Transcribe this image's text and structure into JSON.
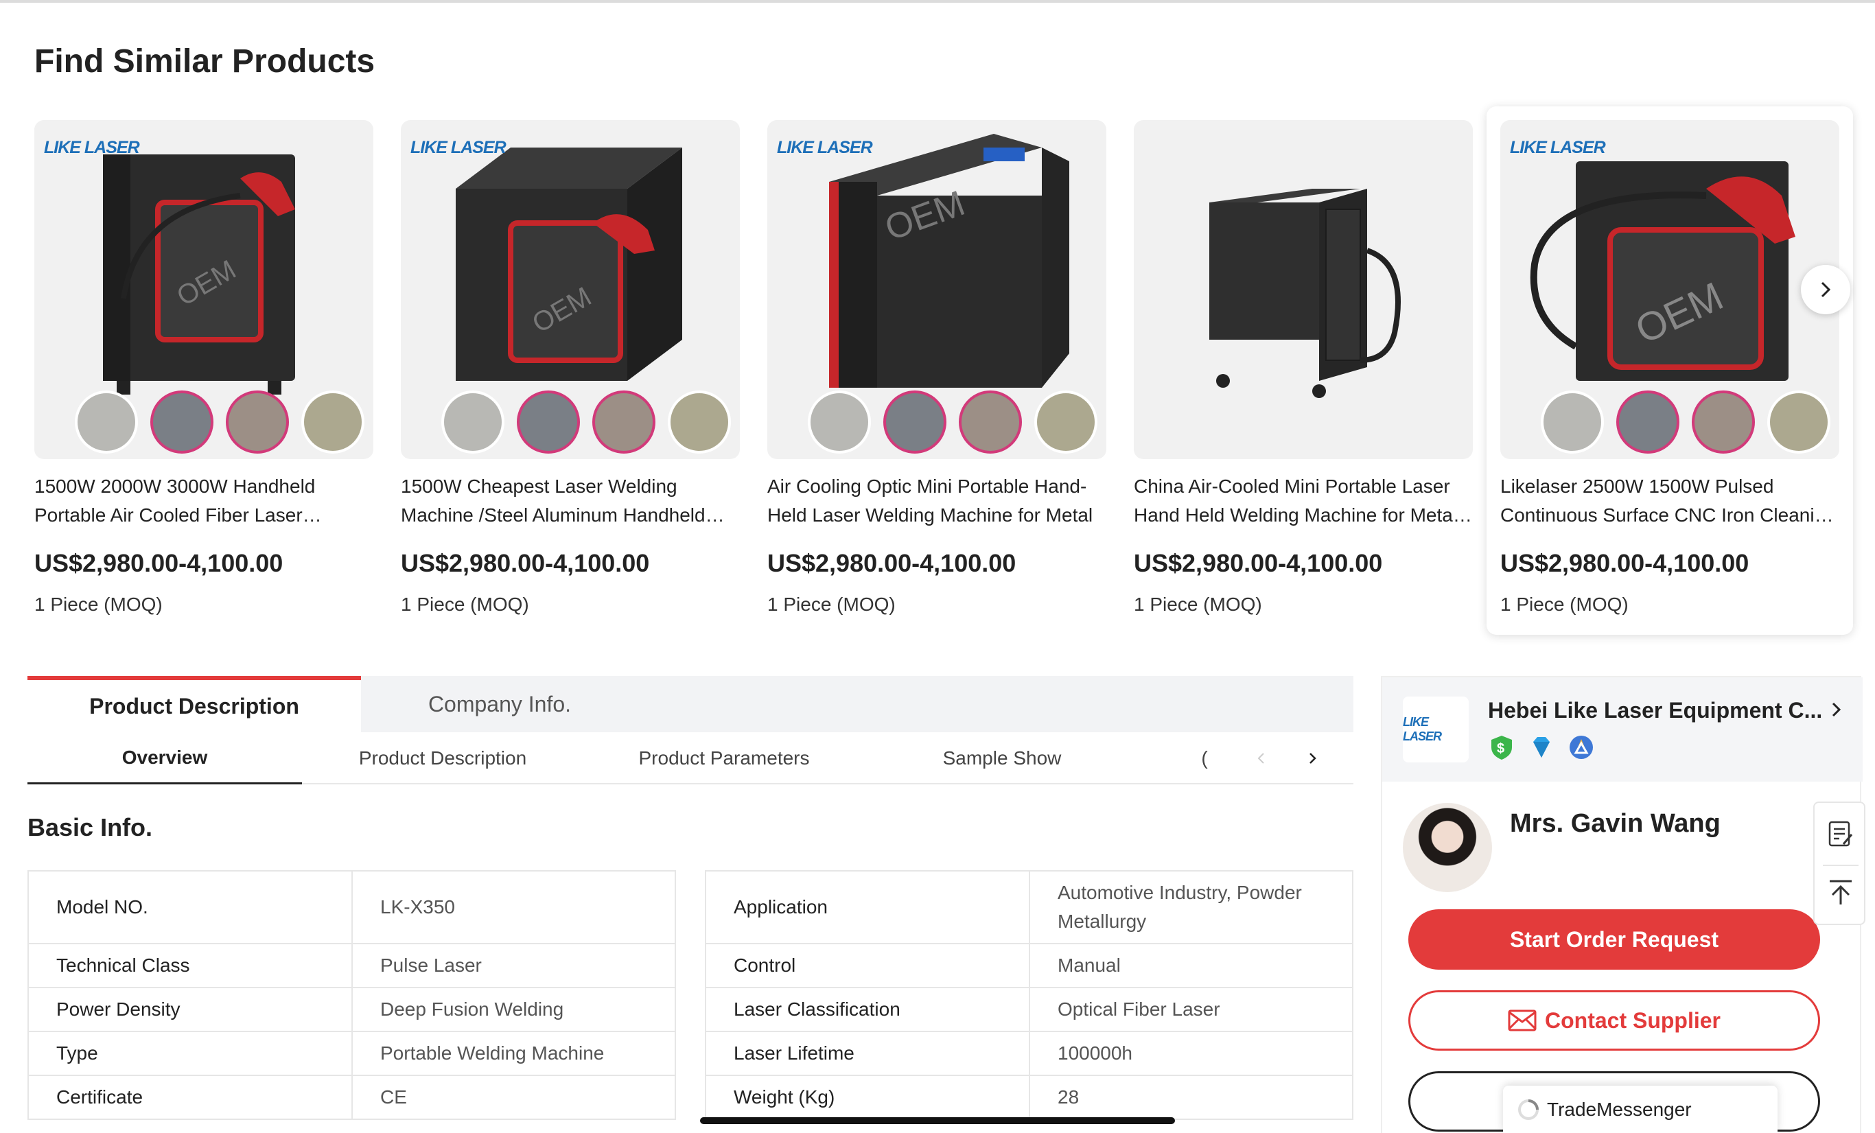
{
  "section_title": "Find Similar Products",
  "products": [
    {
      "brand": "LIKE LASER",
      "name": "1500W 2000W 3000W Handheld Portable Air Cooled Fiber Laser Welding Machine",
      "price": "US$2,980.00-4,100.00",
      "moq": "1 Piece (MOQ)",
      "watermark": "OEM"
    },
    {
      "brand": "LIKE LASER",
      "name": "1500W Cheapest Laser Welding Machine /Steel Aluminum Handheld Laser Welder",
      "price": "US$2,980.00-4,100.00",
      "moq": "1 Piece (MOQ)",
      "watermark": "OEM"
    },
    {
      "brand": "LIKE LASER",
      "name": "Air Cooling Optic Mini Portable Hand-Held Laser Welding Machine for Metal",
      "price": "US$2,980.00-4,100.00",
      "moq": "1 Piece (MOQ)",
      "watermark": "OEM"
    },
    {
      "brand": "",
      "name": "China Air-Cooled Mini Portable Laser Hand Held Welding Machine for Metal Welding",
      "price": "US$2,980.00-4,100.00",
      "moq": "1 Piece (MOQ)",
      "watermark": ""
    },
    {
      "brand": "LIKE LASER",
      "name": "Likelaser 2500W 1500W Pulsed Continuous Surface CNC Iron Cleaning Machine",
      "price": "US$2,980.00-4,100.00",
      "moq": "1 Piece (MOQ)",
      "watermark": "OEM"
    }
  ],
  "tabs": {
    "active": "Product Description",
    "company": "Company Info."
  },
  "subnav": [
    "Overview",
    "Product Description",
    "Product Parameters",
    "Sample Show",
    "("
  ],
  "basic_info_title": "Basic Info.",
  "spec_left": [
    {
      "key": "Model NO.",
      "value": "LK-X350"
    },
    {
      "key": "Technical Class",
      "value": "Pulse Laser"
    },
    {
      "key": "Power Density",
      "value": "Deep Fusion Welding"
    },
    {
      "key": "Type",
      "value": "Portable Welding Machine"
    },
    {
      "key": "Certificate",
      "value": "CE"
    }
  ],
  "spec_right": [
    {
      "key": "Application",
      "value": "Automotive Industry, Powder Metallurgy"
    },
    {
      "key": "Control",
      "value": "Manual"
    },
    {
      "key": "Laser Classification",
      "value": "Optical Fiber Laser"
    },
    {
      "key": "Laser Lifetime",
      "value": "100000h"
    },
    {
      "key": "Weight (Kg)",
      "value": "28"
    }
  ],
  "supplier": {
    "logo_text": "LIKE LASER",
    "company_name": "Hebei Like Laser Equipment C...",
    "contact_name": "Mrs. Gavin Wang",
    "order_button": "Start Order Request",
    "contact_button": "Contact Supplier"
  },
  "trademessenger": "TradeMessenger",
  "colors": {
    "accent": "#e33b3b",
    "brand_blue": "#1d6fb8"
  }
}
